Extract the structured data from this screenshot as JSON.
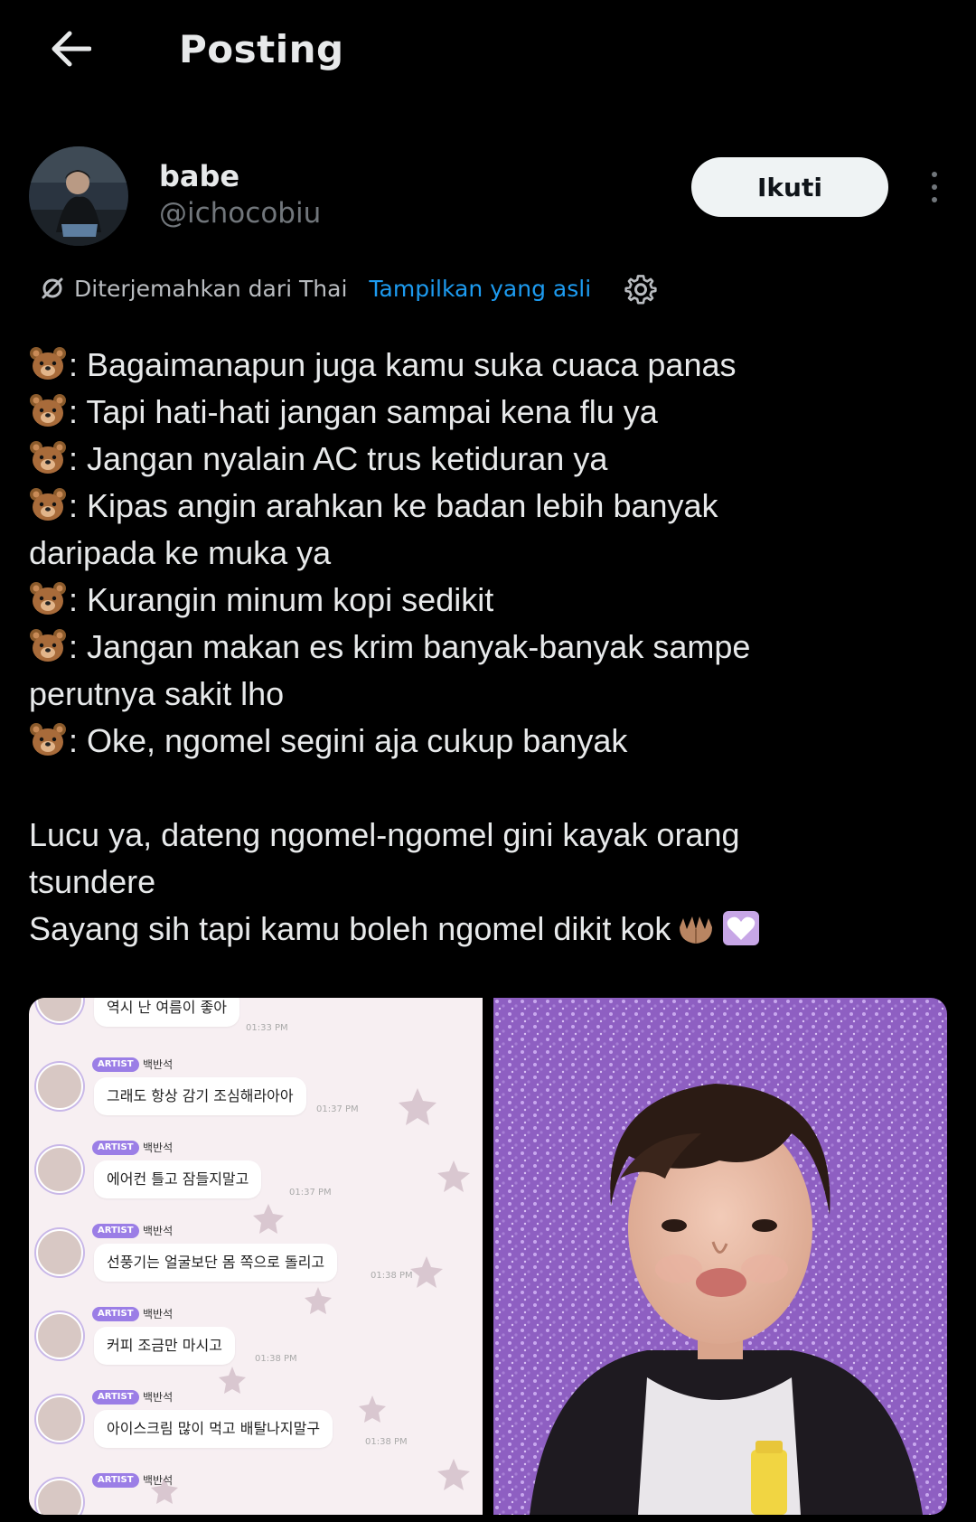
{
  "header": {
    "title": "Posting",
    "back_icon": "arrow-left-icon"
  },
  "author": {
    "display_name": "babe",
    "handle": "@ichocobiu",
    "follow_label": "Ikuti"
  },
  "translation": {
    "translated_from": "Diterjemahkan dari Thai",
    "show_original": "Tampilkan yang asli"
  },
  "post": {
    "lines": [
      ": Bagaimanapun juga kamu suka cuaca panas",
      ": Tapi hati-hati jangan sampai kena flu ya",
      ": Jangan nyalain AC trus ketiduran ya",
      ": Kipas angin arahkan ke badan lebih banyak",
      "daripada ke muka ya",
      ": Kurangin minum kopi sedikit",
      ": Jangan makan es krim banyak-banyak sampe",
      "perutnya sakit lho",
      ": Oke, ngomel segini aja cukup banyak",
      "Lucu ya, dateng ngomel-ngomel gini kayak orang",
      "tsundere",
      "Sayang sih tapi kamu boleh ngomel dikit kok"
    ]
  },
  "media": {
    "chat": {
      "first_message": "역시 난 여름이 좋아",
      "first_time": "01:33 PM",
      "artist_tag": "ARTIST",
      "artist_name": "백반석",
      "messages": [
        {
          "text": "그래도 항상 감기 조심해라아아",
          "time": "01:37 PM"
        },
        {
          "text": "에어컨 틀고 잠들지말고",
          "time": "01:37 PM"
        },
        {
          "text": "선풍기는 얼굴보단 몸 쪽으로 돌리고",
          "time": "01:38 PM"
        },
        {
          "text": "커피 조금만 마시고",
          "time": "01:38 PM"
        },
        {
          "text": "아이스크림 많이 먹고 배탈나지말구",
          "time": "01:38 PM"
        }
      ]
    }
  },
  "colors": {
    "background": "#000000",
    "text": "#e7e9ea",
    "secondary": "#71767b",
    "link": "#1d9bf0",
    "follow_bg": "#eff3f4"
  }
}
